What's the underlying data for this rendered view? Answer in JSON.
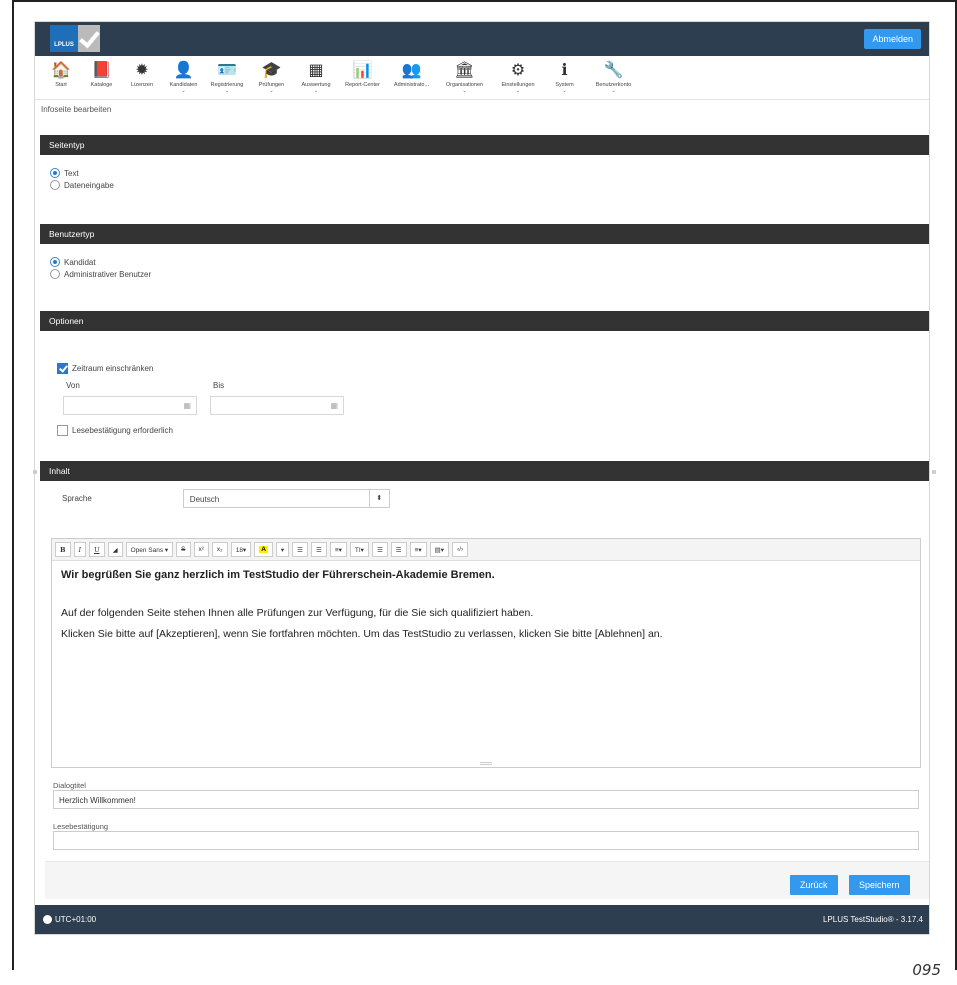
{
  "header": {
    "logo_text": "LPLUS",
    "logout_label": "Abmelden"
  },
  "nav": [
    {
      "label": "Start",
      "icon": "home-icon",
      "glyph": "🏠",
      "has_caret": false
    },
    {
      "label": "Kataloge",
      "icon": "book-icon",
      "glyph": "📕",
      "has_caret": false
    },
    {
      "label": "Lizenzen",
      "icon": "seal-icon",
      "glyph": "✹",
      "has_caret": false
    },
    {
      "label": "Kandidaten",
      "icon": "user-icon",
      "glyph": "👤",
      "has_caret": true
    },
    {
      "label": "Registrierung",
      "icon": "id-card-icon",
      "glyph": "🪪",
      "has_caret": true
    },
    {
      "label": "Prüfungen",
      "icon": "graduation-cap-icon",
      "glyph": "🎓",
      "has_caret": true
    },
    {
      "label": "Auswertung",
      "icon": "table-icon",
      "glyph": "▦",
      "has_caret": true
    },
    {
      "label": "Report-Center",
      "icon": "bar-chart-icon",
      "glyph": "📊",
      "has_caret": false
    },
    {
      "label": "Administrato...",
      "icon": "users-icon",
      "glyph": "👥",
      "has_caret": false
    },
    {
      "label": "Organisationen",
      "icon": "building-icon",
      "glyph": "🏛",
      "has_caret": true
    },
    {
      "label": "Einstellungen",
      "icon": "gears-icon",
      "glyph": "⚙",
      "has_caret": true
    },
    {
      "label": "System",
      "icon": "info-icon",
      "glyph": "ℹ",
      "has_caret": true
    },
    {
      "label": "Benutzerkonto",
      "icon": "wrench-icon",
      "glyph": "🔧",
      "has_caret": true
    }
  ],
  "page_title": "Infoseite bearbeiten",
  "sections": {
    "seitentyp": {
      "title": "Seitentyp",
      "options": [
        {
          "label": "Text",
          "selected": true
        },
        {
          "label": "Dateneingabe",
          "selected": false
        }
      ]
    },
    "benutzertyp": {
      "title": "Benutzertyp",
      "options": [
        {
          "label": "Kandidat",
          "selected": true
        },
        {
          "label": "Administrativer Benutzer",
          "selected": false
        }
      ]
    },
    "optionen": {
      "title": "Optionen",
      "restrict_label": "Zeitraum einschränken",
      "restrict_checked": true,
      "from_label": "Von",
      "to_label": "Bis",
      "from_value": "",
      "to_value": "",
      "confirm_label": "Lesebestätigung erforderlich",
      "confirm_checked": false
    },
    "inhalt": {
      "title": "Inhalt",
      "language_label": "Sprache",
      "language_value": "Deutsch"
    }
  },
  "editor": {
    "toolbar": {
      "bold": "B",
      "italic": "I",
      "underline": "U",
      "font": "Open Sans ▾",
      "strike": "S",
      "sup": "x²",
      "sub": "x₂",
      "size": "18▾",
      "color": "A",
      "textstyle": "TI▾",
      "code": "‹/›"
    },
    "heading": "Wir begrüßen Sie ganz herzlich im TestStudio der Führerschein-Akademie Bremen.",
    "paragraphs": [
      "Auf der folgenden Seite stehen Ihnen alle Prüfungen zur Verfügung, für die Sie sich qualifiziert haben.",
      "Klicken Sie bitte auf [Akzeptieren], wenn Sie fortfahren möchten. Um das TestStudio zu verlassen, klicken Sie bitte [Ablehnen] an."
    ]
  },
  "dialog_title": {
    "label": "Dialogtitel",
    "value": "Herzlich Willkommen!"
  },
  "read_confirmation": {
    "label": "Lesebestätigung",
    "value": ""
  },
  "buttons": {
    "back": "Zurück",
    "save": "Speichern"
  },
  "status": {
    "timezone": "UTC+01:00",
    "version": "LPLUS TestStudio® - 3.17.4"
  },
  "page_number": "095"
}
